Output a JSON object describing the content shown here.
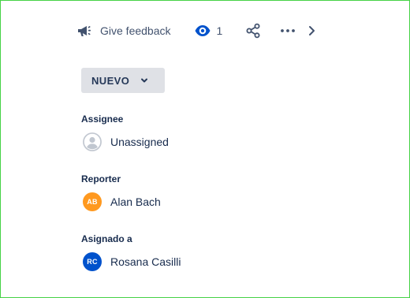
{
  "toolbar": {
    "feedback_label": "Give feedback",
    "watch_count": "1",
    "icons": {
      "feedback": "megaphone-icon",
      "watch": "eye-icon",
      "share": "share-icon",
      "more": "more-horizontal-icon",
      "next": "chevron-right-icon"
    }
  },
  "status": {
    "label": "NUEVO",
    "icon": "chevron-down-icon"
  },
  "fields": {
    "assignee": {
      "label": "Assignee",
      "value": "Unassigned",
      "avatar_icon": "default-avatar-icon"
    },
    "reporter": {
      "label": "Reporter",
      "value": "Alan Bach",
      "initials": "AB",
      "avatar_color": "#ff991f"
    },
    "asignado": {
      "label": "Asignado a",
      "value": "Rosana Casilli",
      "initials": "RC",
      "avatar_color": "#0052cc"
    }
  },
  "colors": {
    "text": "#172b4d",
    "subtle_text": "#42526e",
    "status_bg": "#dfe1e6",
    "frame_border": "#46d246"
  }
}
